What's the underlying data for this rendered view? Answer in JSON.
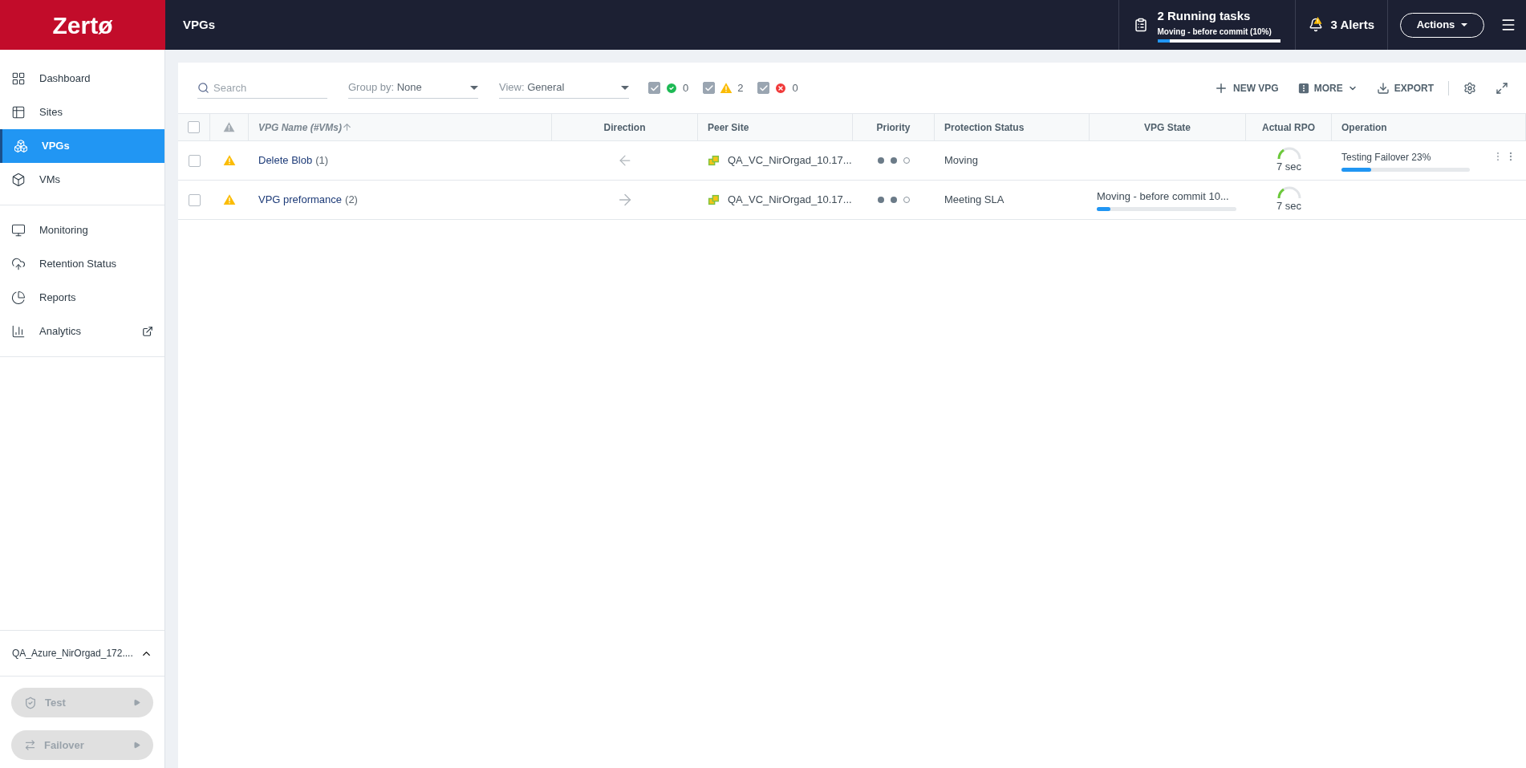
{
  "header": {
    "logo": "Zertø",
    "title": "VPGs",
    "tasks": {
      "title": "2 Running tasks",
      "detail": "Moving - before commit (10%)",
      "level": 0.1
    },
    "alerts": "3 Alerts",
    "actions_button": "Actions"
  },
  "sidebar": {
    "sections": [
      {
        "items": [
          {
            "label": "Dashboard",
            "selected": false
          },
          {
            "label": "Sites",
            "selected": false
          },
          {
            "label": "VPGs",
            "selected": true
          },
          {
            "label": "VMs",
            "selected": false
          }
        ]
      },
      {
        "items": [
          {
            "label": "Monitoring",
            "selected": false
          },
          {
            "label": "Retention Status",
            "selected": false
          },
          {
            "label": "Reports",
            "selected": false
          },
          {
            "label": "Analytics",
            "selected": false,
            "external": true
          }
        ]
      }
    ],
    "site": {
      "label": "QA_Azure_NirOrgad_172....",
      "expanded": true
    },
    "buttons": [
      {
        "label": "Test",
        "disabled": true
      },
      {
        "label": "Failover",
        "disabled": true
      }
    ]
  },
  "toolbar": {
    "search": {
      "placeholder": "Search"
    },
    "group_by": {
      "label": "Group by:",
      "value": "None"
    },
    "view": {
      "label": "View:",
      "value": "General"
    },
    "filters": [
      {
        "kind": "ok",
        "checked": true,
        "count": "0"
      },
      {
        "kind": "warning",
        "checked": true,
        "count": "2"
      },
      {
        "kind": "error",
        "checked": true,
        "count": "0"
      }
    ],
    "actions": [
      {
        "kind": "add",
        "label": "NEW VPG"
      },
      {
        "kind": "more",
        "label": "MORE"
      },
      {
        "kind": "export",
        "label": "EXPORT"
      }
    ]
  },
  "table": {
    "columns": [
      "VPG Name (#VMs)",
      "Direction",
      "Peer Site",
      "Priority",
      "Protection Status",
      "VPG State",
      "Actual RPO",
      "Operation"
    ],
    "all_checked": false,
    "rows": [
      {
        "checked": false,
        "name": "Delete Blob",
        "vms": "(1)",
        "direction": {
          "kind": "in"
        },
        "peer_site": "QA_VC_NirOrgad_10.17...",
        "stars": 2,
        "protection_status": "Moving",
        "rpo": "7 sec",
        "operation": {
          "text": "Testing Failover 23%",
          "level": 0.23
        }
      },
      {
        "checked": false,
        "name": "VPG preformance",
        "vms": "(2)",
        "direction": {
          "kind": "out"
        },
        "peer_site": "QA_VC_NirOrgad_10.17...",
        "stars": 2,
        "protection_status": "Meeting SLA",
        "vpg_state": {
          "text": "Moving - before commit 10...",
          "level": 0.1
        },
        "rpo": "7 sec"
      }
    ]
  }
}
